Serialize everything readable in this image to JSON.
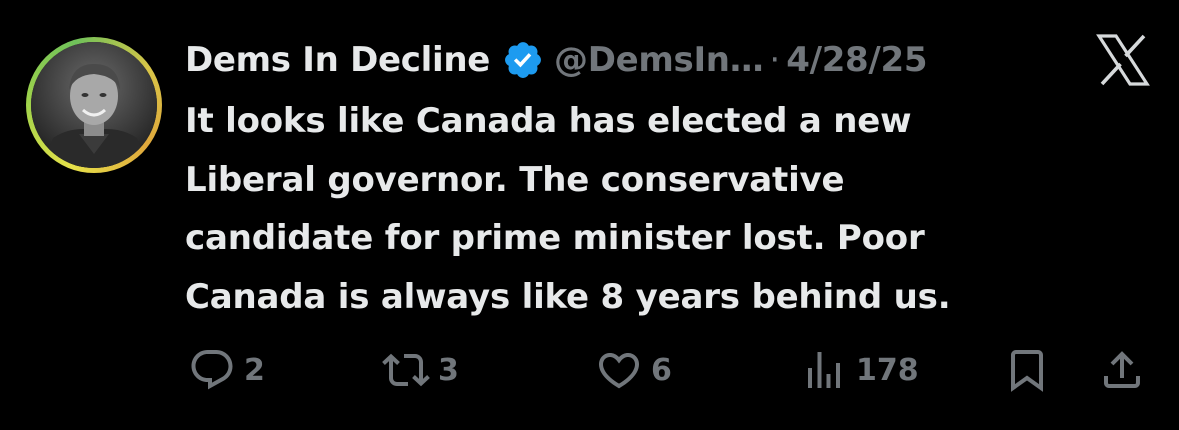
{
  "author": {
    "name": "Dems In Decline",
    "handle": "@DemsIn…",
    "separator": "·",
    "date": "4/28/25"
  },
  "tweet": {
    "lines": [
      "It looks like Canada has elected a new",
      "Liberal governor. The conservative",
      "candidate for prime minister lost. Poor",
      "Canada is always like 8 years behind us."
    ]
  },
  "actions": {
    "replies": "2",
    "reposts": "3",
    "likes": "6",
    "views": "178"
  },
  "icons": {
    "verified": "verified-badge-icon",
    "platform": "x-logo-icon",
    "reply": "reply-icon",
    "repost": "repost-icon",
    "like": "heart-icon",
    "views": "views-icon",
    "bookmark": "bookmark-icon",
    "share": "share-icon"
  },
  "colors": {
    "background": "#000000",
    "text": "#e7e9ea",
    "secondary": "#71767b",
    "verified": "#1d9bf0"
  }
}
